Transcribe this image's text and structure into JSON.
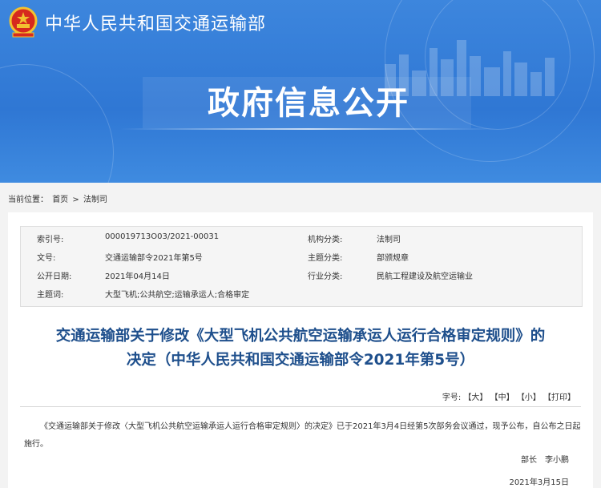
{
  "site": {
    "name": "中华人民共和国交通运输部"
  },
  "banner": {
    "title": "政府信息公开"
  },
  "breadcrumb": {
    "prefix": "当前位置：",
    "home": "首页",
    "sep": ">",
    "current": "法制司"
  },
  "meta": {
    "rows": [
      {
        "k1": "索引号:",
        "v1": "000019713O03/2021-00031",
        "k2": "机构分类:",
        "v2": "法制司"
      },
      {
        "k1": "文号:",
        "v1": "交通运输部令2021年第5号",
        "k2": "主题分类:",
        "v2": "部颁规章"
      },
      {
        "k1": "公开日期:",
        "v1": "2021年04月14日",
        "k2": "行业分类:",
        "v2": "民航工程建设及航空运输业"
      },
      {
        "k1": "主题词:",
        "v1": "大型飞机;公共航空;运输承运人;合格审定"
      }
    ]
  },
  "document": {
    "title_line1": "交通运输部关于修改《大型飞机公共航空运输承运人运行合格审定规则》的",
    "title_line2": "决定（中华人民共和国交通运输部令2021年第5号）",
    "body": "《交通运输部关于修改〈大型飞机公共航空运输承运人运行合格审定规则〉的决定》已于2021年3月4日经第5次部务会议通过，现予公布，自公布之日起施行。",
    "signature": "部长　李小鹏",
    "date": "2021年3月15日"
  },
  "font_size_bar": {
    "label": "字号:",
    "large": "【大】",
    "medium": "【中】",
    "small": "【小】",
    "print": "【打印】"
  }
}
